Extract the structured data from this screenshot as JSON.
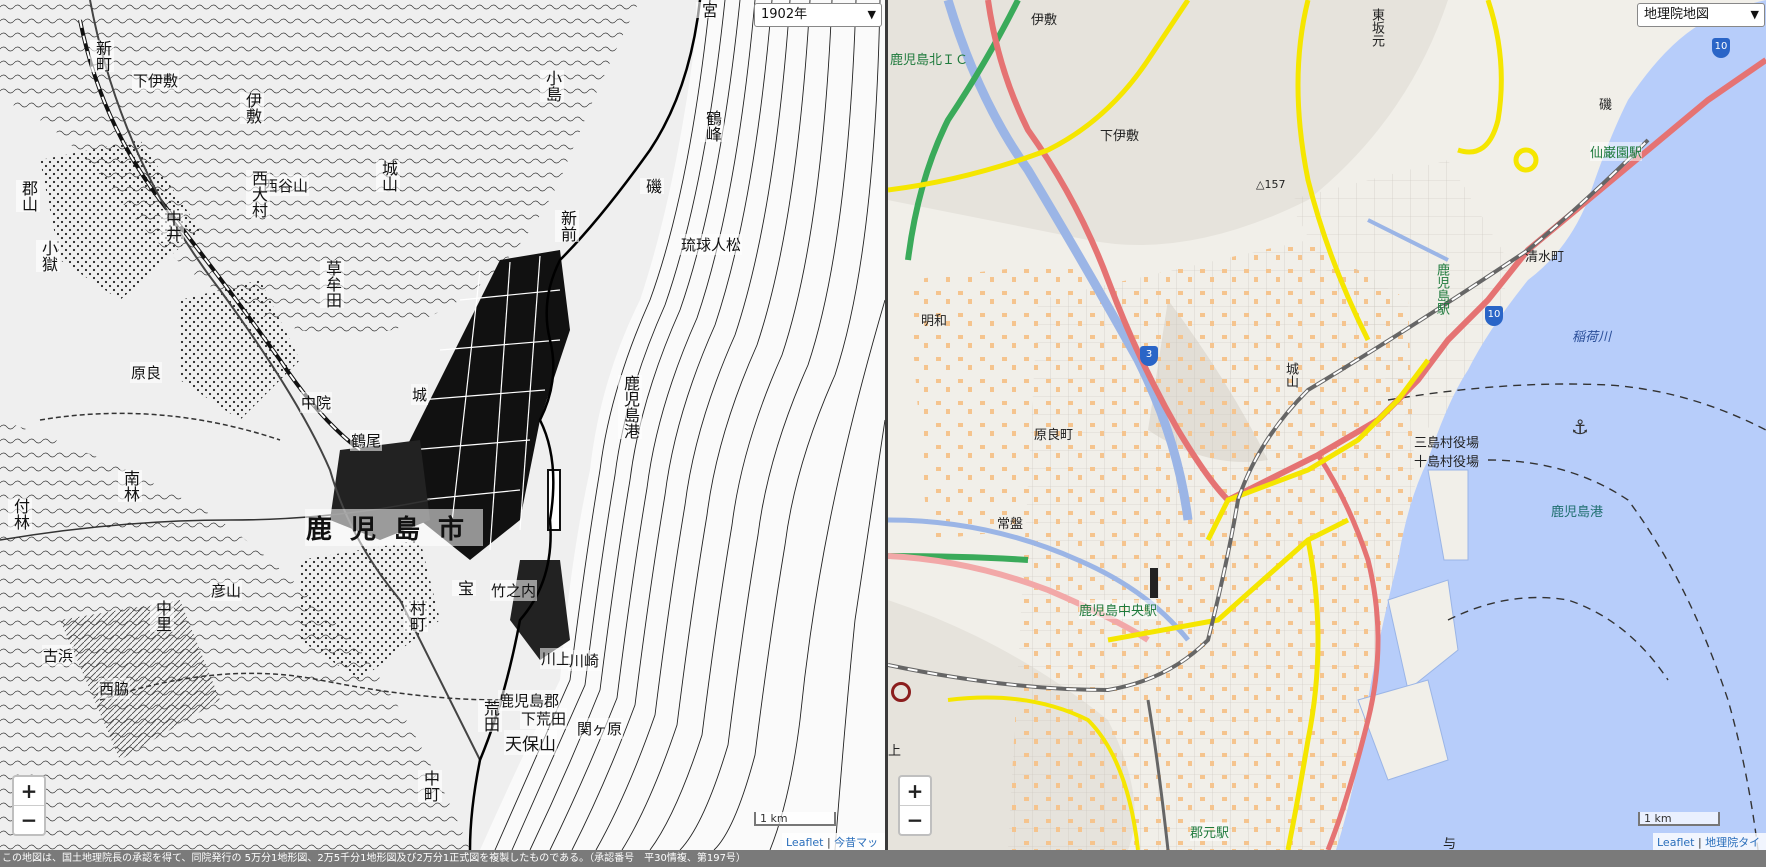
{
  "left_map": {
    "year_select": "1902年",
    "labels": {
      "miyagi": "宮",
      "ishiki": "伊敷",
      "shimoishiki": "下伊敷",
      "nishitaniyama": "西谷山",
      "koriyama": "郡山",
      "chuin": "中院",
      "harara": "原良",
      "kusamuta": "草牟田",
      "nakai": "中井",
      "tsuruo": "鶴尾",
      "shiro": "城",
      "kagoshima_minato": "鹿児島港",
      "shinzen": "新前",
      "minamibayashi": "南林",
      "koshigoku": "小獄",
      "kagoshima_city": "鹿児島市",
      "tsukebayashi": "付林",
      "isohayashi": "磯",
      "takenouchi": "竹之内",
      "kawakami": "川上",
      "shinmachi": "新町",
      "shirokawa": "城山",
      "ryukyu": "琉球人松",
      "tsurugamine": "鶴峰",
      "nishiomura": "西大村",
      "nakazato": "中里",
      "furuhama": "古浜",
      "muramachi": "村町",
      "hikosan": "彦山",
      "kojima": "小島",
      "nishiwaki": "西脇",
      "tenpozan": "天保山",
      "kawasaki": "川崎",
      "takara": "宝",
      "kagoshima_gun": "鹿児島郡",
      "arata": "荒田",
      "seikigahara": "関ヶ原",
      "shimoaraki": "下荒田",
      "nakamachi": "中町"
    },
    "zoom_in": "+",
    "zoom_out": "−",
    "scale_label": "1 km",
    "attribution_leaflet": "Leaflet",
    "attribution_sep": "|",
    "attribution_konjaku": "今昔マップ"
  },
  "right_map": {
    "layer_select": "地理院地図",
    "labels": {
      "ishiki": "伊敷",
      "kagoshima_kita_ic": "鹿児島北ＩＣ",
      "shimoishiki": "下伊敷",
      "higashisakamoto": "東坂元",
      "iso": "磯",
      "senganen_station": "仙巌園駅",
      "peak_157": "△157",
      "kagoshima_station": "鹿児島駅",
      "shimizumachi": "清水町",
      "meiwa": "明和",
      "inarigawa": "稲荷川",
      "shiroyama": "城山",
      "harara_cho": "原良町",
      "mishima_office": "三島村役場",
      "toshima_office": "十島村役場",
      "tokiwa": "常盤",
      "kagoshima_port": "鹿児島港",
      "kagoshima_chuo_station": "鹿児島中央駅",
      "korimoto_station": "郡元駅",
      "yo": "与",
      "kami": "上"
    },
    "route_shields": {
      "r3": "3",
      "r10_a": "10",
      "r10_b": "10"
    },
    "zoom_in": "+",
    "zoom_out": "−",
    "scale_label": "1 km",
    "attribution_leaflet": "Leaflet",
    "attribution_sep": "|",
    "attribution_gsi": "地理院タイル"
  },
  "footer_text": "この地図は、国土地理院長の承認を得て、同院発行の 5万分1地形図、2万5千分1地形図及び2万分1正式図を複製したものである。（承認番号　平30情複、第197号）",
  "colors": {
    "sea": "#b7cdfa",
    "road_red": "#e57373",
    "road_yellow": "#f5e600",
    "expressway_green": "#3aaa5a",
    "river_blue": "#9bb5e6"
  }
}
